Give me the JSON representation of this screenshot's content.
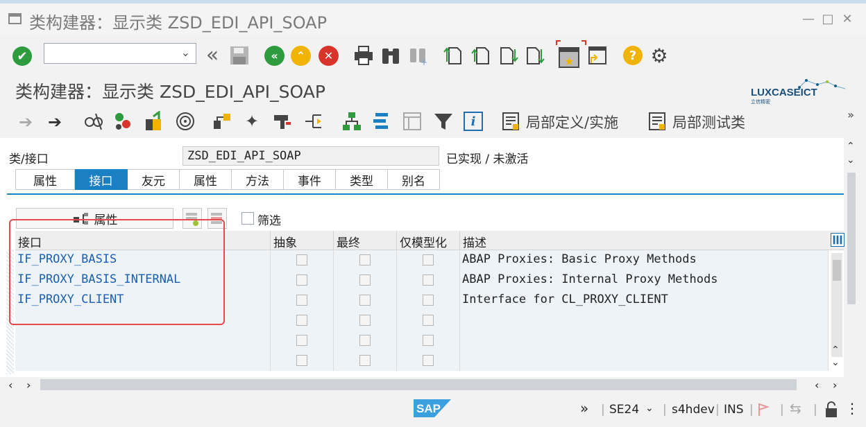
{
  "window": {
    "title": "类构建器：显示类 ZSD_EDI_API_SOAP"
  },
  "toolbar": {
    "command_value": ""
  },
  "header": {
    "title": "类构建器：显示类 ZSD_EDI_API_SOAP",
    "logo_text": "LUXCASEICT",
    "logo_subtext": "立信精密"
  },
  "appbar": {
    "local_def_label": "局部定义/实施",
    "local_test_label": "局部测试类"
  },
  "class_field": {
    "label": "类/接口",
    "value": "ZSD_EDI_API_SOAP",
    "status": "已实现 / 未激活"
  },
  "tabs": [
    {
      "label": "属性",
      "active": false
    },
    {
      "label": "接口",
      "active": true
    },
    {
      "label": "友元",
      "active": false
    },
    {
      "label": "属性",
      "active": false
    },
    {
      "label": "方法",
      "active": false
    },
    {
      "label": "事件",
      "active": false
    },
    {
      "label": "类型",
      "active": false
    },
    {
      "label": "别名",
      "active": false
    }
  ],
  "table_toolbar": {
    "attr_button": "属性",
    "filter_label": "筛选"
  },
  "grid": {
    "headers": [
      "接口",
      "抽象",
      "最终",
      "仅模型化",
      "描述"
    ],
    "rows": [
      {
        "interface": "IF_PROXY_BASIS",
        "desc": "ABAP Proxies: Basic Proxy Methods"
      },
      {
        "interface": "IF_PROXY_BASIS_INTERNAL",
        "desc": "ABAP Proxies: Internal Proxy Methods"
      },
      {
        "interface": "IF_PROXY_CLIENT",
        "desc": "Interface for CL_PROXY_CLIENT"
      },
      {
        "interface": "",
        "desc": ""
      },
      {
        "interface": "",
        "desc": ""
      },
      {
        "interface": "",
        "desc": ""
      }
    ]
  },
  "statusbar": {
    "tcode": "SE24",
    "system": "s4hdev",
    "mode": "INS",
    "sap_logo": "SAP"
  },
  "colors": {
    "accent": "#1b7fc4",
    "link": "#1a5fb4",
    "highlight_box": "#e5484d",
    "ok_green": "#2e9b3e",
    "stop_red": "#d9342b",
    "help_yellow": "#f0b400"
  }
}
